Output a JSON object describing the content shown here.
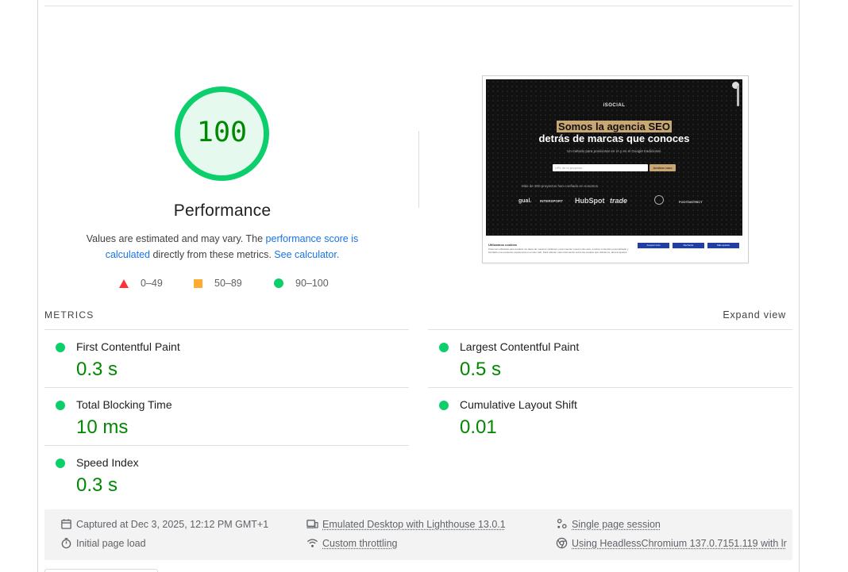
{
  "gauge": {
    "score": "100",
    "title": "Performance",
    "color": "#0cce6b"
  },
  "description": {
    "text_1": "Values are estimated and may vary. The ",
    "link_1": "performance score is calculated",
    "text_2": " directly from these metrics. ",
    "link_2": "See calculator."
  },
  "legend": [
    {
      "shape": "triangle",
      "label": "0–49",
      "color": "#ff3333"
    },
    {
      "shape": "square",
      "label": "50–89",
      "color": "#ffaa33"
    },
    {
      "shape": "circle",
      "label": "90–100",
      "color": "#0cce6b"
    }
  ],
  "thumbnail": {
    "logo": "iSOCIAL",
    "headline_highlight": "Somos la agencia SEO",
    "headline_line2": "detrás de marcas que conoces",
    "subtitle": "Un método para posicionar en IA y en el Google tradicional.",
    "input_placeholder": "URL de tu proyecto",
    "button": "Analizar caso",
    "trust_text": "Más de 300 proyectos han confiado en nosotros",
    "brands": [
      "gual.",
      "INTERSPORT",
      "HubSpot",
      "trade",
      "",
      "FOOTDISTRICT"
    ],
    "cookie_title": "Utilizamos cookies",
    "cookie_text": "Podemos utilizarlas para analizar los datos de nuestros visitantes, para mejorar nuestro sitio web, mostrar contenido personalizado y brindarle una excelente experiencia en el sitio web. Para obtener más información sobre las cookies que utilizamos, abra la ajustes.",
    "cookie_buttons": [
      "Aceptar todo",
      "Rechazar",
      "Más ajustes"
    ]
  },
  "metrics": {
    "heading": "METRICS",
    "expand": "Expand view",
    "items": [
      {
        "name": "First Contentful Paint",
        "value": "0.3 s"
      },
      {
        "name": "Largest Contentful Paint",
        "value": "0.5 s"
      },
      {
        "name": "Total Blocking Time",
        "value": "10 ms"
      },
      {
        "name": "Cumulative Layout Shift",
        "value": "0.01"
      },
      {
        "name": "Speed Index",
        "value": "0.3 s"
      }
    ]
  },
  "info": {
    "captured": "Captured at Dec 3, 2025, 12:12 PM GMT+1",
    "load": "Initial page load",
    "emulated": "Emulated Desktop with Lighthouse 13.0.1",
    "throttling": "Custom throttling",
    "session": "Single page session",
    "browser": "Using HeadlessChromium 137.0.7151.119 with lr"
  },
  "colors": {
    "pass": "#0cce6b",
    "pass_text": "#008800",
    "link": "#1a73e8"
  }
}
